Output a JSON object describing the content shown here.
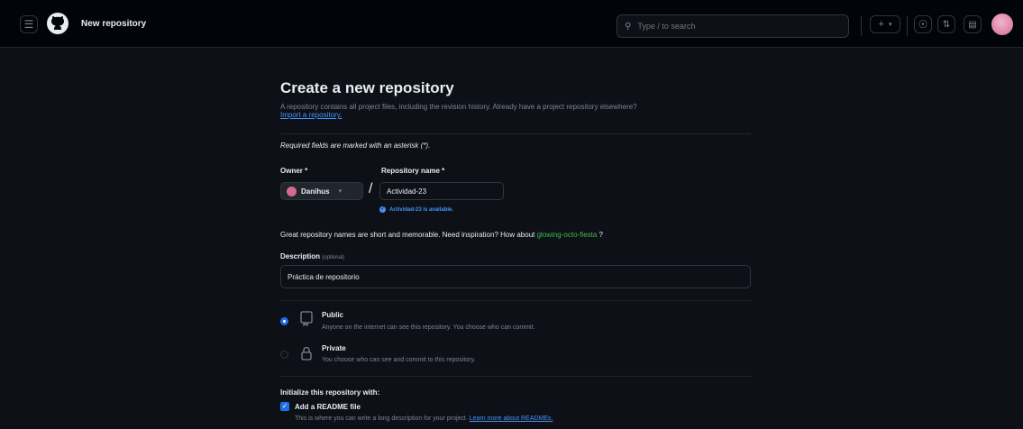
{
  "header": {
    "title": "New repository",
    "search_placeholder": "Type / to search"
  },
  "main": {
    "heading": "Create a new repository",
    "description": "A repository contains all project files, including the revision history. Already have a project repository elsewhere?",
    "import_link": "Import a repository.",
    "required_note": "Required fields are marked with an asterisk (*).",
    "owner_label": "Owner *",
    "owner_value": "Danihus",
    "repo_label": "Repository name *",
    "repo_value": "Actividad-23",
    "availability": "Actividad-23 is available.",
    "inspiration_text": "Great repository names are short and memorable. Need inspiration? How about",
    "inspiration_suggestion": "glowing-octo-fiesta",
    "inspiration_suffix": "?",
    "description_label": "Description",
    "description_optional": "(optional)",
    "description_value": "Práctica de repositorio",
    "visibility": {
      "public_label": "Public",
      "public_desc": "Anyone on the internet can see this repository. You choose who can commit.",
      "private_label": "Private",
      "private_desc": "You choose who can see and commit to this repository."
    },
    "init_heading": "Initialize this repository with:",
    "readme_label": "Add a README file",
    "readme_desc": "This is where you can write a long description for your project.",
    "readme_link": "Learn more about READMEs."
  },
  "colors": {
    "accent": "#1f6feb",
    "link": "#4493f8",
    "success": "#3fb950",
    "background": "#0d1117"
  }
}
